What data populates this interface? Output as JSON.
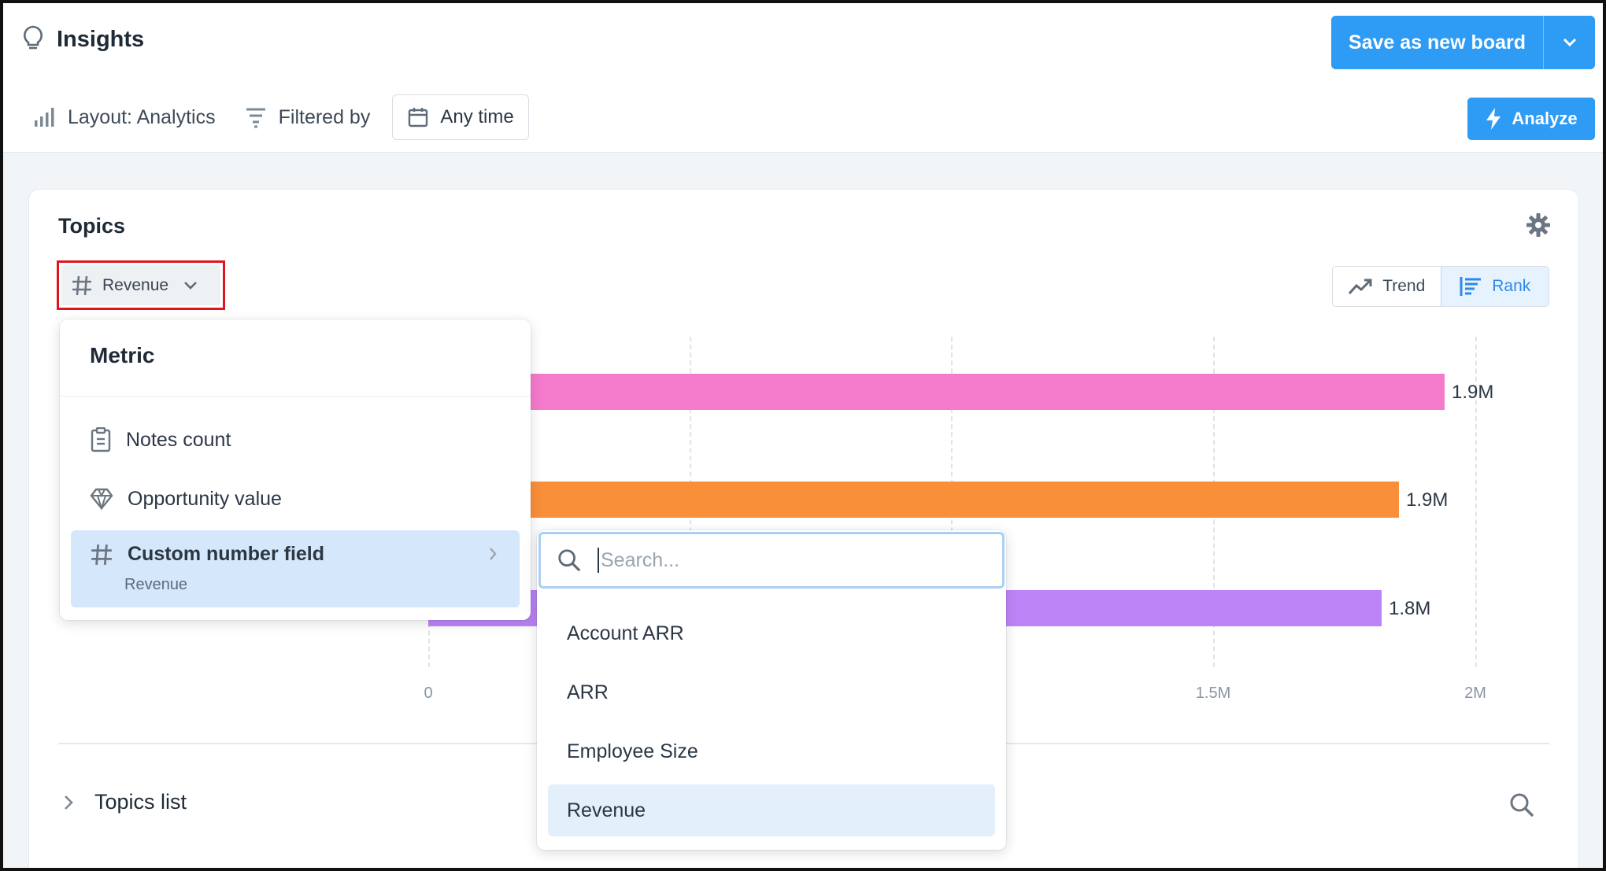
{
  "header": {
    "title": "Insights",
    "save_button": "Save as new board",
    "layout_label": "Layout: Analytics",
    "filter_label": "Filtered by",
    "time_filter": "Any time",
    "analyze_button": "Analyze"
  },
  "card": {
    "title": "Topics",
    "metric_selector": "Revenue",
    "view_toggle": {
      "trend": "Trend",
      "rank": "Rank",
      "active": "Rank"
    },
    "topics_list": "Topics list"
  },
  "metric_menu": {
    "heading": "Metric",
    "items": [
      {
        "label": "Notes count",
        "icon": "clipboard-icon"
      },
      {
        "label": "Opportunity value",
        "icon": "diamond-icon"
      },
      {
        "label": "Custom number field",
        "sublabel": "Revenue",
        "icon": "hash-icon",
        "selected": true
      }
    ]
  },
  "field_menu": {
    "search_placeholder": "Search...",
    "items": [
      {
        "label": "Account ARR"
      },
      {
        "label": "ARR"
      },
      {
        "label": "Employee Size"
      },
      {
        "label": "Revenue",
        "selected": true
      }
    ]
  },
  "chart_data": {
    "type": "bar",
    "orientation": "horizontal",
    "series": [
      {
        "values": [
          1.9,
          1.9,
          1.8
        ],
        "labels": [
          "1.9M",
          "1.9M",
          "1.8M"
        ],
        "colors": [
          "#f47acb",
          "#fa8f3a",
          "#bd84f7"
        ]
      }
    ],
    "x_ticks": [
      "0",
      "1.5M",
      "2M"
    ],
    "xlim": [
      0,
      2000000
    ],
    "values": [
      1900000,
      1820000,
      1830000
    ]
  },
  "colors": {
    "primary": "#2e9bf5",
    "selected_bg": "#d5e7fb",
    "highlight_border": "#e0141e"
  }
}
